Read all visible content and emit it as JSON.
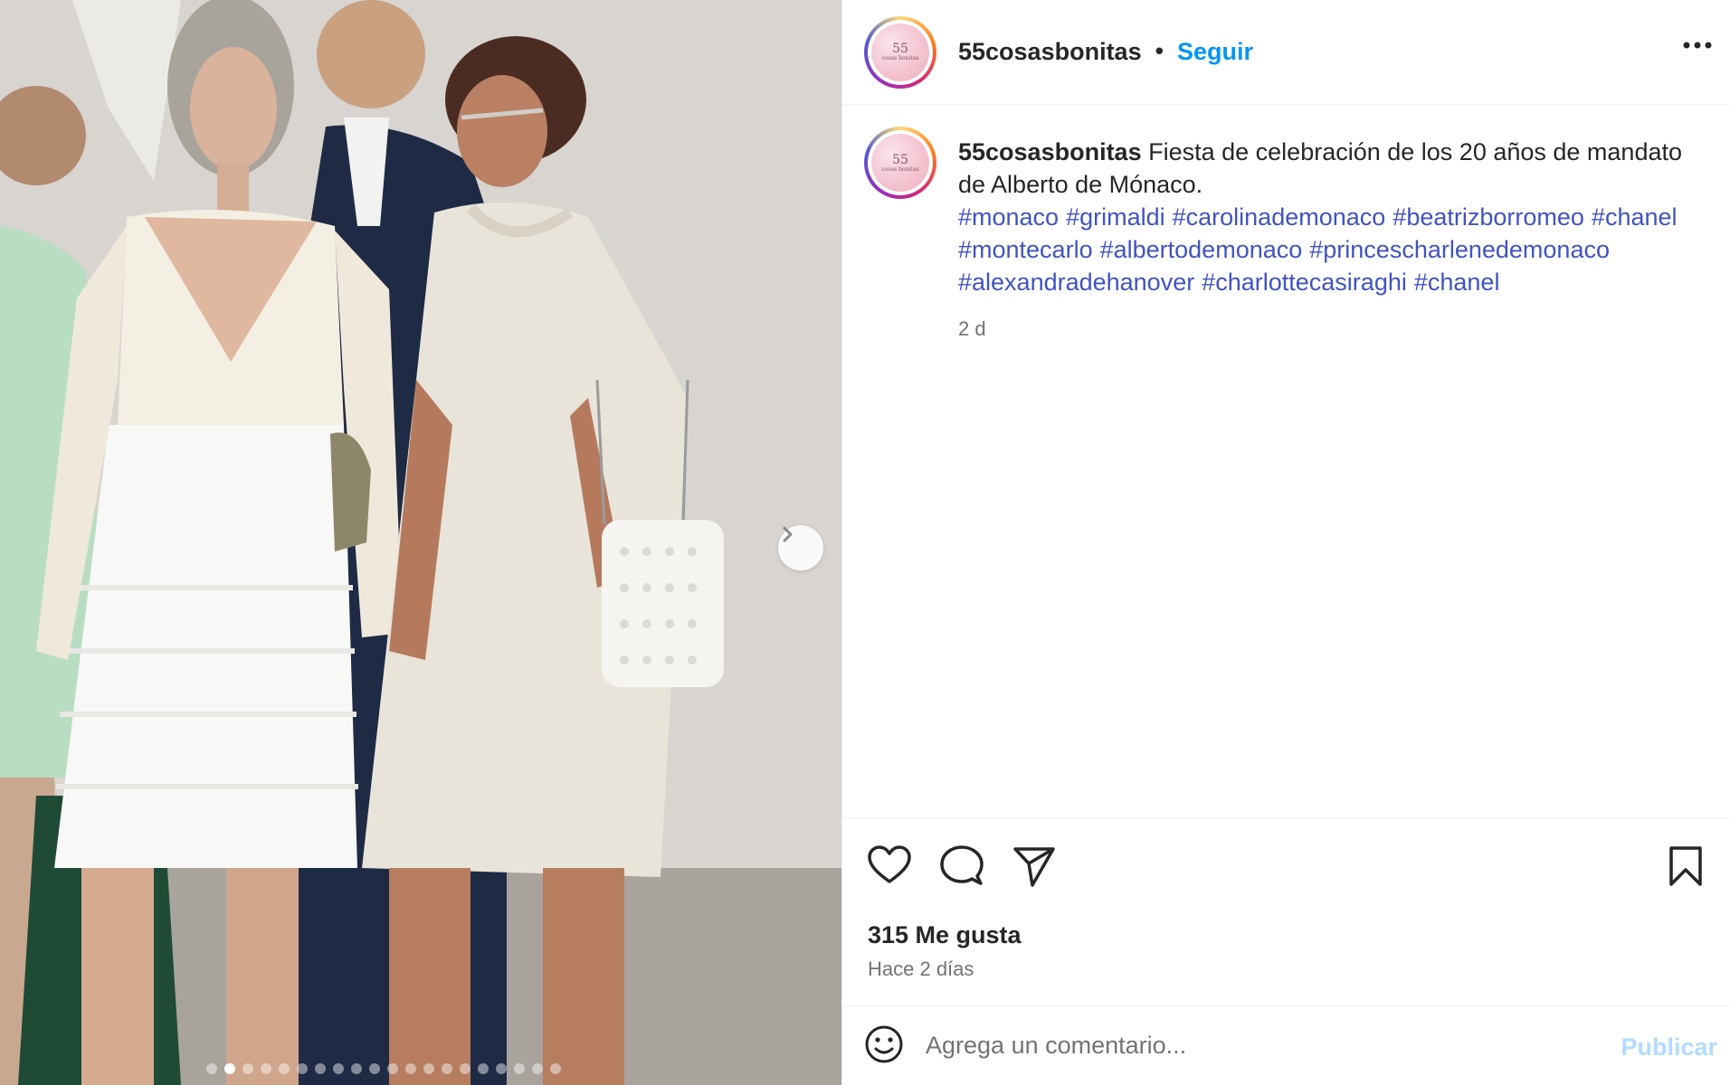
{
  "post": {
    "username": "55cosasbonitas",
    "separator": "•",
    "follow_label": "Seguir",
    "avatar_text": "55",
    "avatar_subtext": "cosas bonitas",
    "caption": {
      "username": "55cosasbonitas",
      "text": "Fiesta de celebración de los 20 años de mandato de Alberto de Mónaco.",
      "hashtags": [
        "#monaco",
        "#grimaldi",
        "#carolinademonaco",
        "#beatrizborromeo",
        "#chanel",
        "#montecarlo",
        "#albertodemonaco",
        "#princescharlenedemonaco",
        "#alexandradehanover",
        "#charlottecasiraghi",
        "#chanel"
      ],
      "time": "2 d"
    },
    "likes": "315 Me gusta",
    "date": "Hace 2 días",
    "comment": {
      "placeholder": "Agrega un comentario...",
      "value": "",
      "publish_label": "Publicar"
    }
  },
  "carousel": {
    "total_slides": 20,
    "active_index": 1
  },
  "icons": {
    "more": "more-horizontal-icon",
    "like": "heart-icon",
    "comment": "comment-icon",
    "share": "send-icon",
    "save": "bookmark-icon",
    "emoji": "emoji-icon",
    "next": "chevron-right-icon"
  },
  "colors": {
    "link": "#0095f6",
    "hashtag": "#4053c3",
    "muted": "#737373",
    "publish_disabled": "#b3dbff"
  }
}
